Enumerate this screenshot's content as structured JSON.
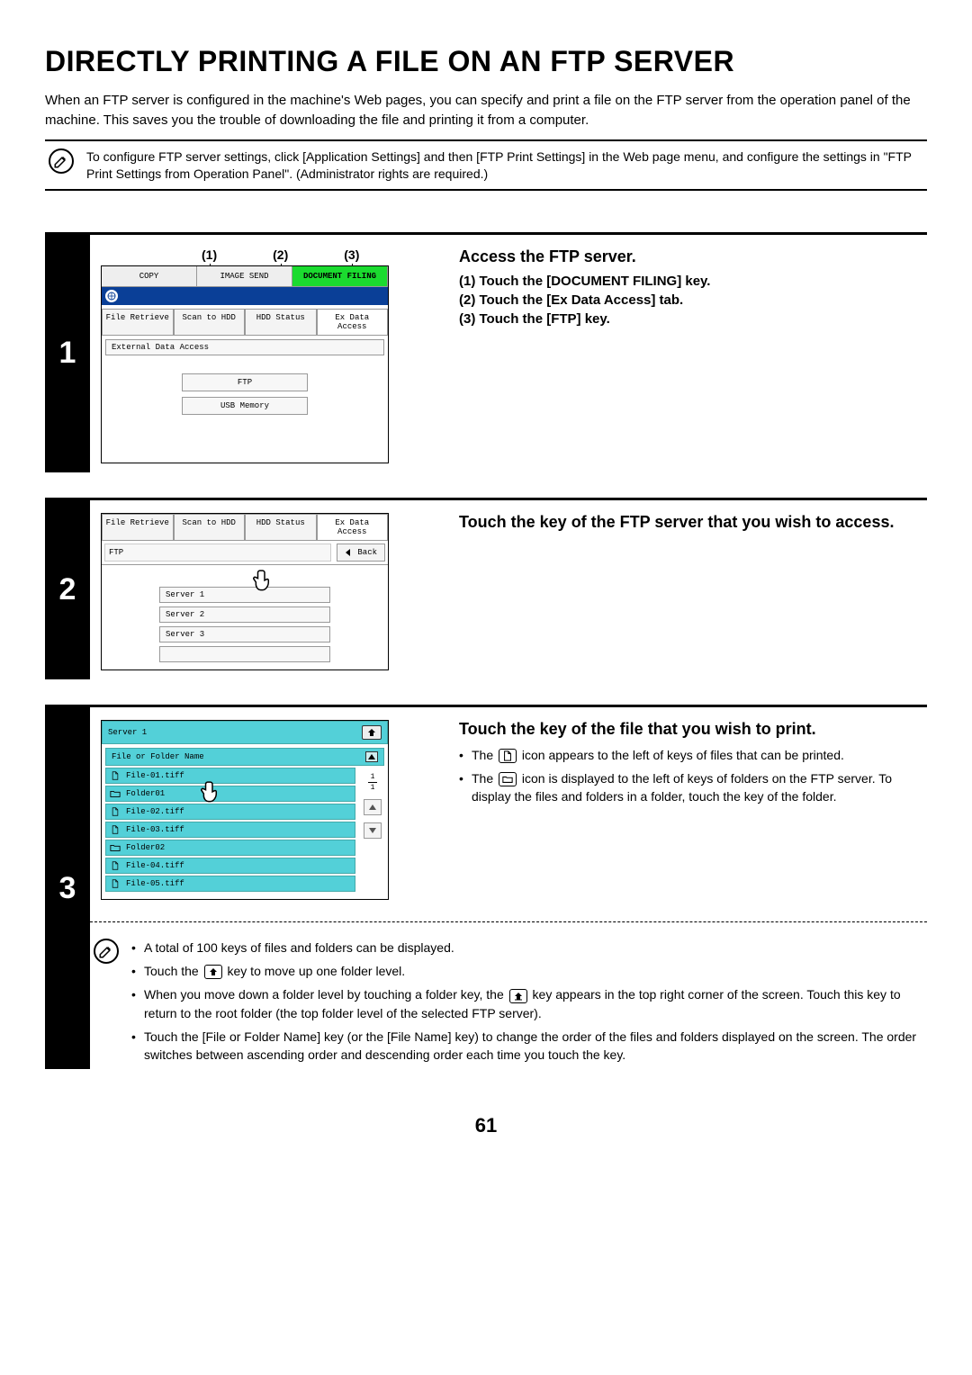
{
  "page_title": "DIRECTLY PRINTING A FILE ON AN FTP SERVER",
  "intro": "When an FTP server is configured in the machine's Web pages, you can specify and print a file on the FTP server from the operation panel of the machine. This saves you the trouble of downloading the file and printing it from a computer.",
  "top_note": "To configure FTP server settings, click [Application Settings] and then [FTP Print Settings] in the Web page menu, and configure the settings in \"FTP Print Settings from Operation Panel\". (Administrator rights are required.)",
  "callouts": {
    "c1": "(1)",
    "c2": "(2)",
    "c3": "(3)"
  },
  "step1": {
    "title": "Access the FTP server.",
    "sub1": "(1)  Touch the [DOCUMENT FILING] key.",
    "sub2": "(2)  Touch the [Ex Data Access] tab.",
    "sub3": "(3)  Touch the [FTP] key.",
    "screen": {
      "tabs": {
        "copy": "COPY",
        "image_send": "IMAGE SEND",
        "doc_filing": "DOCUMENT FILING"
      },
      "subtabs": {
        "file_retrieve": "File Retrieve",
        "scan_hdd": "Scan to HDD",
        "hdd_status": "HDD Status",
        "ex_data": "Ex Data Access"
      },
      "row_label": "External Data Access",
      "btn_ftp": "FTP",
      "btn_usb": "USB Memory"
    }
  },
  "step2": {
    "title": "Touch the key of the FTP server that you wish to access.",
    "screen": {
      "tabs": {
        "file_retrieve": "File Retrieve",
        "scan_hdd": "Scan to HDD",
        "hdd_status": "HDD Status",
        "ex_data": "Ex Data Access"
      },
      "label": "FTP",
      "back": "Back",
      "server1": "Server 1",
      "server2": "Server 2",
      "server3": "Server 3"
    }
  },
  "step3": {
    "title": "Touch the key of the file that you wish to print.",
    "bullet1a": "The ",
    "bullet1b": " icon appears to the left of keys of files that can be printed.",
    "bullet2a": "The ",
    "bullet2b": " icon is displayed to the left of keys of folders on the FTP server. To display the files and folders in a folder, touch the key of the folder.",
    "screen": {
      "server": "Server 1",
      "col_header": "File or Folder Name",
      "rows": [
        {
          "type": "file",
          "name": "File-01.tiff"
        },
        {
          "type": "folder",
          "name": "Folder01"
        },
        {
          "type": "file",
          "name": "File-02.tiff"
        },
        {
          "type": "file",
          "name": "File-03.tiff"
        },
        {
          "type": "folder",
          "name": "Folder02"
        },
        {
          "type": "file",
          "name": "File-04.tiff"
        },
        {
          "type": "file",
          "name": "File-05.tiff"
        }
      ],
      "page_current": "1",
      "page_total": "1"
    },
    "notes": {
      "n1": "A total of 100 keys of files and folders can be displayed.",
      "n2a": "Touch the ",
      "n2b": " key to move up one folder level.",
      "n3a": "When you move down a folder level by touching a folder key, the ",
      "n3b": " key appears in the top right corner of the screen. Touch this key to return to the root folder (the top folder level of the selected FTP server).",
      "n4": "Touch the [File or Folder Name] key (or the [File Name] key) to change the order of the files and folders displayed on the screen. The order switches between ascending order and descending order each time you touch the key."
    }
  },
  "page_number": "61"
}
